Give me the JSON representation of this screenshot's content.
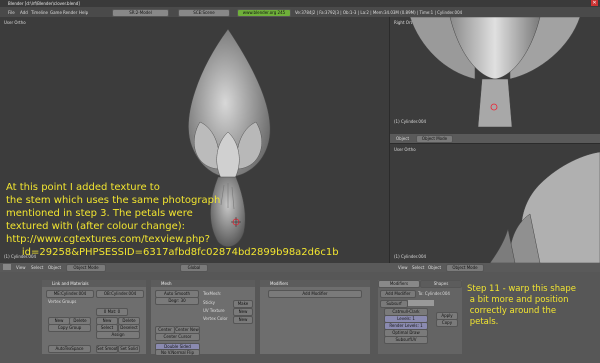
{
  "window_title": "Blender [d:\\lrf\\Blender\\clover.blend]",
  "menu": {
    "items": [
      "File",
      "Add",
      "Timeline",
      "Game",
      "Render",
      "Help"
    ],
    "screen": "SR:2-Model",
    "scene": "SCE:Scene",
    "stats": "Ve:3784|2 | Fa:3792|3 | Ob:1-3 | La:2 | Mem:34.03M (0.89M) | Time:1 | Cylinder.004"
  },
  "views": {
    "user_ortho_main": "User Ortho",
    "right_ortho": "Right Ortho",
    "user_ortho_br": "User Ortho",
    "object_label_main": "(1) Cylinder.004",
    "object_label_right": "(1) Cylinder.004",
    "object_label_br": "(1) Cylinder.004"
  },
  "view3d_header": {
    "view": "View",
    "select": "Select",
    "object": "Object",
    "mode": "Object Mode",
    "global": "Global"
  },
  "buttons_panel": {
    "link_title": "Link and Materials",
    "me_field": "ME:Cylinder.004",
    "ob_field": "OB:Cylinder.004",
    "vertex_groups": "Vertex Groups",
    "mat_field": "0 Mat: 0",
    "new": "New",
    "delete": "Delete",
    "copy_group": "Copy Group",
    "assign": "Assign",
    "select": "Select",
    "deselect": "Deselect",
    "set_smooth": "Set Smooth",
    "set_solid": "Set Solid",
    "autotex": "AutoTexSpace",
    "mesh_title": "Mesh",
    "auto_smooth": "Auto Smooth",
    "degr": "Degr: 30",
    "sticky": "Sticky",
    "uv_texture": "UV Texture",
    "vertex_color": "Vertex Color",
    "make": "Make",
    "center": "Center",
    "center_new": "Center New",
    "center_cursor": "Center Cursor",
    "double_sided": "Double Sided",
    "no_v_normal_flip": "No V.Normal Flip",
    "texmesh": "TexMesh:",
    "modifiers_title": "Modifiers",
    "add_modifier": "Add Modifier",
    "modifiers_tab": "Modifiers",
    "shapes_tab": "Shapes",
    "to_label": "To: Cylinder.004",
    "subsurf": "Subsurf",
    "catmull": "Catmull-Clark",
    "levels": "Levels: 1",
    "render_levels": "Render Levels: 1",
    "optimal_draw": "Optimal Draw",
    "subsurf_uv": "SubsurfUV",
    "apply": "Apply",
    "copy": "Copy",
    "status_green": "www.blender.org 245"
  },
  "annotations": {
    "main": "At this point I added texture to\nthe stem which uses the same photograph\nmentioned in step 3. The petals were\ntextured with (after colour change):\nhttp://www.cgtextures.com/texview.php?\n     id=29258&PHPSESSID=6317afbd8fc02874bd2899b98a2d6c1b",
    "side": "Step 11 - warp this shape\n a bit more and position\n correctly around the\n petals."
  }
}
